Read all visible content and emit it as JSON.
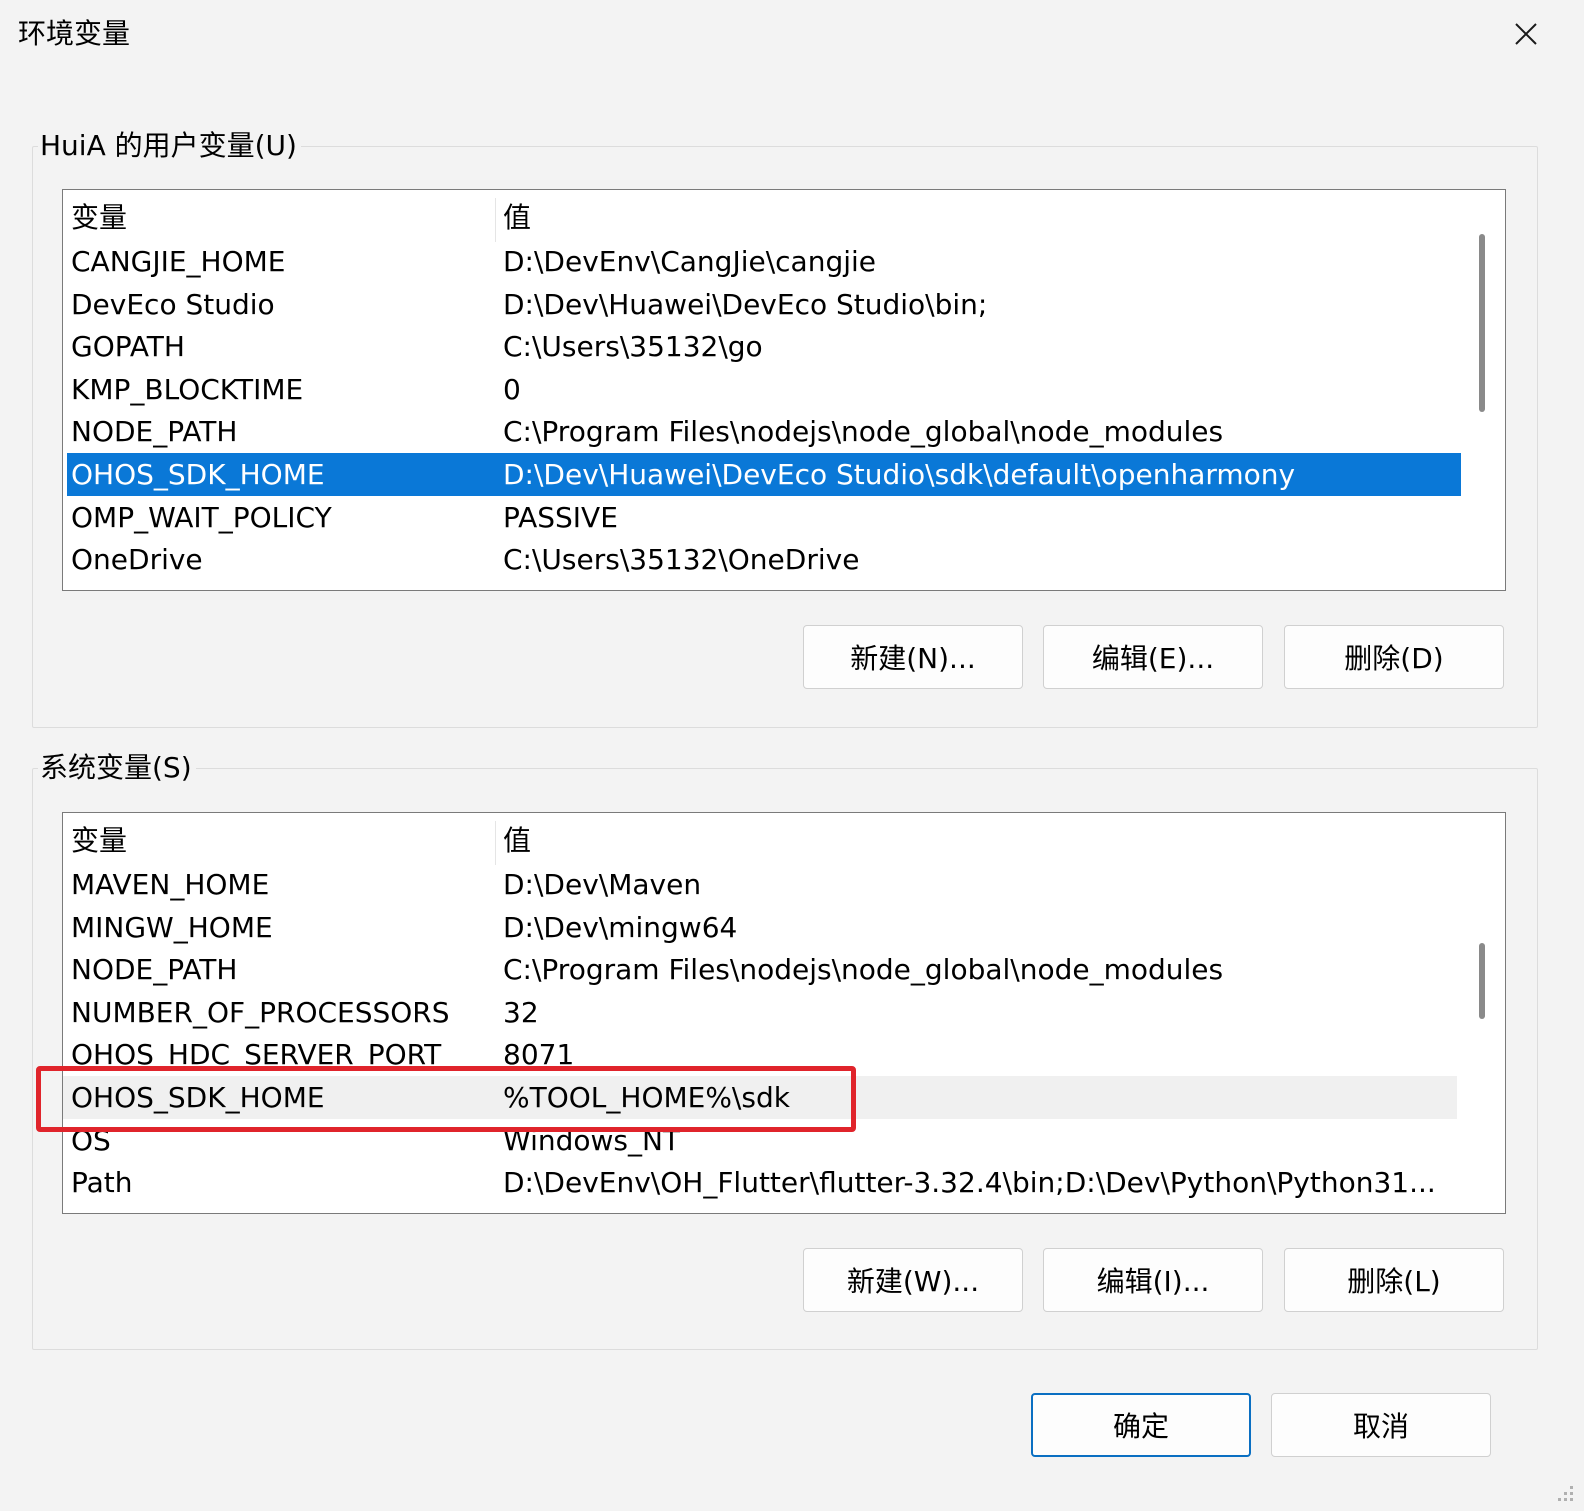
{
  "window": {
    "title": "环境变量"
  },
  "user_vars": {
    "label": "HuiA 的用户变量(U)",
    "header": {
      "col1": "变量",
      "col2": "值"
    },
    "rows": [
      {
        "name": "CANGJIE_HOME",
        "value": "D:\\DevEnv\\CangJie\\cangjie"
      },
      {
        "name": "DevEco Studio",
        "value": "D:\\Dev\\Huawei\\DevEco Studio\\bin;"
      },
      {
        "name": "GOPATH",
        "value": "C:\\Users\\35132\\go"
      },
      {
        "name": "KMP_BLOCKTIME",
        "value": "0"
      },
      {
        "name": "NODE_PATH",
        "value": "C:\\Program Files\\nodejs\\node_global\\node_modules"
      },
      {
        "name": "OHOS_SDK_HOME",
        "value": "D:\\Dev\\Huawei\\DevEco Studio\\sdk\\default\\openharmony",
        "selected": true
      },
      {
        "name": "OMP_WAIT_POLICY",
        "value": "PASSIVE"
      },
      {
        "name": "OneDrive",
        "value": "C:\\Users\\35132\\OneDrive"
      }
    ],
    "buttons": {
      "new": "新建(N)...",
      "edit": "编辑(E)...",
      "delete": "删除(D)"
    }
  },
  "system_vars": {
    "label": "系统变量(S)",
    "header": {
      "col1": "变量",
      "col2": "值"
    },
    "rows": [
      {
        "name": "MAVEN_HOME",
        "value": "D:\\Dev\\Maven"
      },
      {
        "name": "MINGW_HOME",
        "value": "D:\\Dev\\mingw64"
      },
      {
        "name": "NODE_PATH",
        "value": "C:\\Program Files\\nodejs\\node_global\\node_modules"
      },
      {
        "name": "NUMBER_OF_PROCESSORS",
        "value": "32"
      },
      {
        "name": "OHOS_HDC_SERVER_PORT",
        "value": "8071"
      },
      {
        "name": "OHOS_SDK_HOME",
        "value": "%TOOL_HOME%\\sdk",
        "hover": true
      },
      {
        "name": "OS",
        "value": "Windows_NT"
      },
      {
        "name": "Path",
        "value": "D:\\DevEnv\\OH_Flutter\\flutter-3.32.4\\bin;D:\\Dev\\Python\\Python31..."
      }
    ],
    "buttons": {
      "new": "新建(W)...",
      "edit": "编辑(I)...",
      "delete": "删除(L)"
    }
  },
  "footer": {
    "ok": "确定",
    "cancel": "取消"
  },
  "colors": {
    "selection": "#0a78d7",
    "annotation": "#e0242b",
    "default_button_border": "#0a6fc2"
  }
}
